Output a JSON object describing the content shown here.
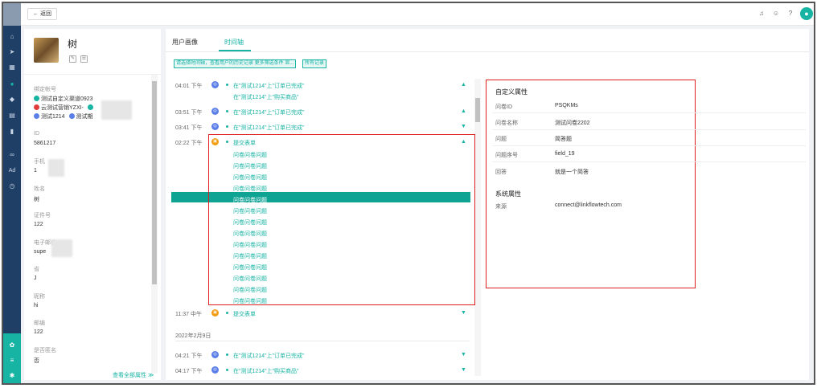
{
  "topbar": {
    "back_label": "← 返回",
    "icons": [
      "bell-icon",
      "chat-icon",
      "help-icon",
      "user-icon"
    ]
  },
  "rail": {
    "icons": [
      "home-icon",
      "send-icon",
      "grid-icon",
      "user-icon",
      "users-icon",
      "form-icon",
      "chart-icon",
      "link-icon",
      "ad-icon",
      "clock-icon",
      "team-icon",
      "menu-icon",
      "settings-icon"
    ],
    "ad_label": "Ad"
  },
  "profile": {
    "name": "树",
    "accounts_label": "绑定帐号",
    "accounts": [
      {
        "name": "测试自定义渠道0923",
        "color": "#17b3a3"
      },
      {
        "name": "云测试营销YZXI-",
        "color": "#e03c3c"
      },
      {
        "name": "测试1214",
        "color": "#5b7fe8",
        "extra": "测试期"
      }
    ],
    "fields": [
      {
        "label": "ID",
        "value": "5861217"
      },
      {
        "label": "手机",
        "value": "1"
      },
      {
        "label": "姓名",
        "value": "树"
      },
      {
        "label": "证件号",
        "value": "122"
      },
      {
        "label": "电子邮件",
        "value": "supe"
      },
      {
        "label": "省",
        "value": "J"
      },
      {
        "label": "昵称",
        "value": "hi"
      },
      {
        "label": "邮编",
        "value": "122"
      },
      {
        "label": "是否匿名",
        "value": "否"
      }
    ],
    "view_all": "查看全部属性 ≫"
  },
  "main": {
    "tabs": [
      {
        "label": "用户画像",
        "active": false
      },
      {
        "label": "时间轴",
        "active": true
      }
    ],
    "chips": [
      "请选择时间轴，查看用户的历史记录 更多筛选条件 显...",
      "所有记录"
    ],
    "timeline": [
      {
        "time": "04:01 下午",
        "badge": "blue",
        "text": "在\"测试1214\"上\"订单已完成\"",
        "sub": "在\"测试1214\"上\"购买商品\"",
        "caret": "▲"
      },
      {
        "time": "03:51 下午",
        "badge": "blue",
        "text": "在\"测试1214\"上\"订单已完成\"",
        "caret": "▲"
      },
      {
        "time": "03:41 下午",
        "badge": "blue",
        "text": "在\"测试1214\"上\"订单已完成\"",
        "caret": "▼"
      },
      {
        "time": "02:22 下午",
        "badge": "orange",
        "text": "提交表单",
        "caret": "▲"
      }
    ],
    "questions": [
      "问卷问卷问题",
      "问卷问卷问题",
      "问卷问卷问题",
      "问卷问卷问题",
      "问卷问卷问题",
      "问卷问卷问题",
      "问卷问卷问题",
      "问卷问卷问题",
      "问卷问卷问题",
      "问卷问卷问题",
      "问卷问卷问题",
      "问卷问卷问题",
      "问卷问卷问题",
      "问卷问卷问题"
    ],
    "highlighted_question_index": 4,
    "after": {
      "time": "11:37 中午",
      "badge": "orange",
      "text": "提交表单",
      "caret": "▼"
    },
    "date_separator": "2022年2月9日",
    "later": [
      {
        "time": "04:21 下午",
        "badge": "blue",
        "text": "在\"测试1214\"上\"订单已完成\"",
        "caret": "▼"
      },
      {
        "time": "04:17 下午",
        "badge": "blue",
        "text": "在\"测试1214\"上\"购买商品\"",
        "caret": "▼"
      }
    ]
  },
  "attributes": {
    "custom_title": "自定义属性",
    "custom": [
      {
        "label": "问卷ID",
        "value": "PSQKMs"
      },
      {
        "label": "问卷名称",
        "value": "测试问卷2202"
      },
      {
        "label": "问题",
        "value": "简答题"
      },
      {
        "label": "问题序号",
        "value": "field_19"
      },
      {
        "label": "回答",
        "value": "就是一个简答"
      }
    ],
    "system_title": "系统属性",
    "system": [
      {
        "label": "来源",
        "value": "connect@linkflowtech.com"
      }
    ]
  },
  "colors": {
    "accent": "#17b3a3",
    "rail": "#1f3f67",
    "annotation": "#e02020"
  }
}
